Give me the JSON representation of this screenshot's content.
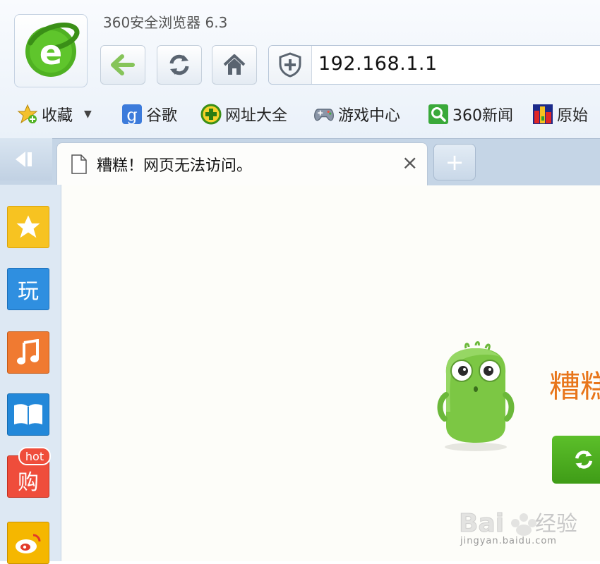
{
  "window": {
    "title": "360安全浏览器 6.3"
  },
  "address_bar": {
    "url": "192.168.1.1"
  },
  "bookmarks": [
    {
      "label": "收藏",
      "icon": "star-icon"
    },
    {
      "label": "谷歌",
      "icon": "google-icon"
    },
    {
      "label": "网址大全",
      "icon": "plus-circle-icon"
    },
    {
      "label": "游戏中心",
      "icon": "gamepad-icon"
    },
    {
      "label": "360新闻",
      "icon": "search-icon"
    },
    {
      "label": "原始",
      "icon": "mosaic-icon"
    }
  ],
  "tab": {
    "title": "糟糕！网页无法访问。",
    "close": "×",
    "new_tab": "+"
  },
  "sidebar": [
    {
      "name": "favorites",
      "icon": "star-icon",
      "color": "#f7c321"
    },
    {
      "name": "play",
      "icon": "玩",
      "color": "#2f8fe0"
    },
    {
      "name": "music",
      "icon": "music-note-icon",
      "color": "#f07a31"
    },
    {
      "name": "reading",
      "icon": "book-icon",
      "color": "#2388d9"
    },
    {
      "name": "shop",
      "icon": "购",
      "badge": "hot",
      "color": "#ef4d3b"
    },
    {
      "name": "weibo",
      "icon": "weibo-icon",
      "color": "#f5b700"
    }
  ],
  "page": {
    "error_heading": "糟糕"
  },
  "watermark": {
    "url": "jingyan.baidu.com",
    "brand_text": "经验"
  },
  "colors": {
    "accent_green": "#4fb122",
    "error_orange": "#e8751a",
    "tab_strip": "#c5d5e6"
  }
}
